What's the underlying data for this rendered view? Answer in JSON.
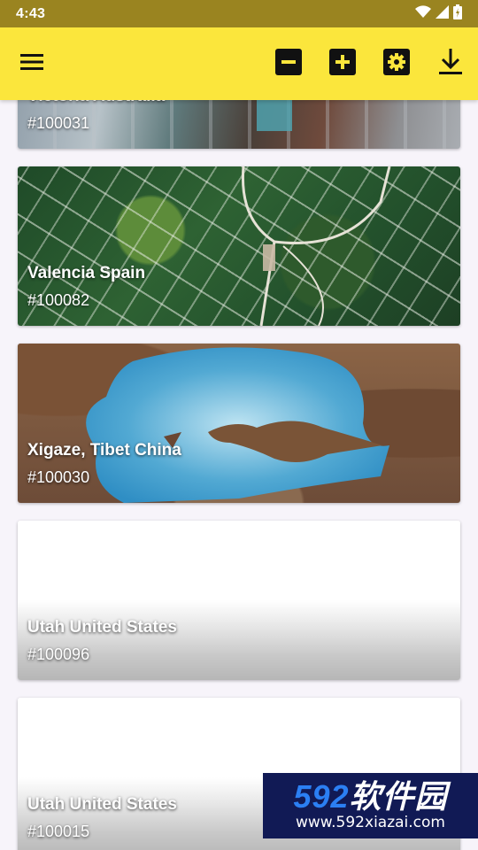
{
  "status_bar": {
    "time": "4:43"
  },
  "toolbar": {
    "menu_icon": "hamburger-menu-icon",
    "buttons": [
      "zoom-out-icon",
      "zoom-in-icon",
      "settings-icon",
      "download-icon"
    ],
    "color": "#fbe63c"
  },
  "cards": [
    {
      "title": "Victoria Australia",
      "number": "#100031"
    },
    {
      "title": "Valencia Spain",
      "number": "#100082"
    },
    {
      "title": "Xigaze, Tibet China",
      "number": "#100030"
    },
    {
      "title": "Utah United States",
      "number": "#100096"
    },
    {
      "title": "Utah United States",
      "number": "#100015"
    }
  ],
  "watermark": {
    "brand_digits": "592",
    "brand_text": "软件园",
    "url": "www.592xiazai.com"
  }
}
